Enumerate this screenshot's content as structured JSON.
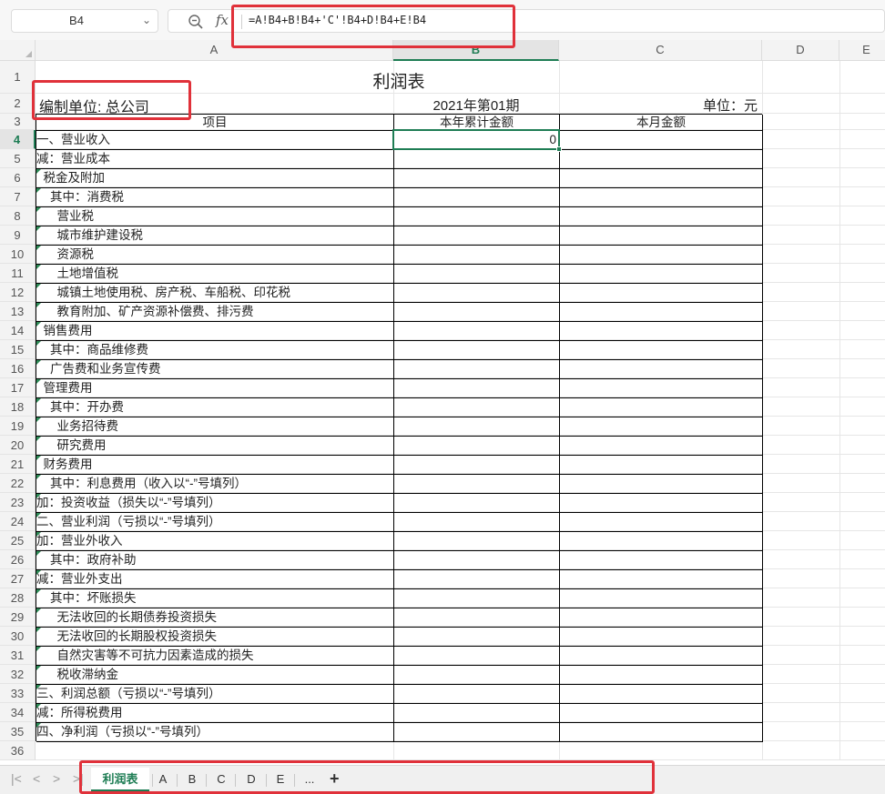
{
  "formula_bar": {
    "cell_ref": "B4",
    "formula": "=A!B4+B!B4+'C'!B4+D!B4+E!B4",
    "fx_label": "fx"
  },
  "columns": [
    "A",
    "B",
    "C",
    "D",
    "E"
  ],
  "active_column": "B",
  "active_row": "4",
  "sheet": {
    "title": "利润表",
    "company_label": "编制单位: 总公司",
    "period": "2021年第01期",
    "unit": "单位：元",
    "headers": [
      "项目",
      "本年累计金额",
      "本月金额"
    ],
    "rows": [
      {
        "item": "一、营业收入",
        "ytd": "0",
        "month": ""
      },
      {
        "item": "减：营业成本",
        "ytd": "",
        "month": ""
      },
      {
        "item": "  税金及附加",
        "ytd": "",
        "month": ""
      },
      {
        "item": "    其中：消费税",
        "ytd": "",
        "month": ""
      },
      {
        "item": "      营业税",
        "ytd": "",
        "month": ""
      },
      {
        "item": "      城市维护建设税",
        "ytd": "",
        "month": ""
      },
      {
        "item": "      资源税",
        "ytd": "",
        "month": ""
      },
      {
        "item": "      土地增值税",
        "ytd": "",
        "month": ""
      },
      {
        "item": "      城镇土地使用税、房产税、车船税、印花税",
        "ytd": "",
        "month": ""
      },
      {
        "item": "      教育附加、矿产资源补偿费、排污费",
        "ytd": "",
        "month": ""
      },
      {
        "item": "  销售费用",
        "ytd": "",
        "month": ""
      },
      {
        "item": "    其中：商品维修费",
        "ytd": "",
        "month": ""
      },
      {
        "item": "    广告费和业务宣传费",
        "ytd": "",
        "month": ""
      },
      {
        "item": "  管理费用",
        "ytd": "",
        "month": ""
      },
      {
        "item": "    其中：开办费",
        "ytd": "",
        "month": ""
      },
      {
        "item": "      业务招待费",
        "ytd": "",
        "month": ""
      },
      {
        "item": "      研究费用",
        "ytd": "",
        "month": ""
      },
      {
        "item": "  财务费用",
        "ytd": "",
        "month": ""
      },
      {
        "item": "    其中：利息费用（收入以“-”号填列）",
        "ytd": "",
        "month": ""
      },
      {
        "item": "加：投资收益（损失以“-”号填列）",
        "ytd": "",
        "month": ""
      },
      {
        "item": "二、营业利润（亏损以“-”号填列）",
        "ytd": "",
        "month": ""
      },
      {
        "item": "加：营业外收入",
        "ytd": "",
        "month": ""
      },
      {
        "item": "    其中：政府补助",
        "ytd": "",
        "month": ""
      },
      {
        "item": "减：营业外支出",
        "ytd": "",
        "month": ""
      },
      {
        "item": "    其中：坏账损失",
        "ytd": "",
        "month": ""
      },
      {
        "item": "      无法收回的长期债券投资损失",
        "ytd": "",
        "month": ""
      },
      {
        "item": "      无法收回的长期股权投资损失",
        "ytd": "",
        "month": ""
      },
      {
        "item": "      自然灾害等不可抗力因素造成的损失",
        "ytd": "",
        "month": ""
      },
      {
        "item": "      税收滞纳金",
        "ytd": "",
        "month": ""
      },
      {
        "item": "三、利润总额（亏损以“-”号填列）",
        "ytd": "",
        "month": ""
      },
      {
        "item": "减：所得税费用",
        "ytd": "",
        "month": ""
      },
      {
        "item": "四、净利润（亏损以“-”号填列）",
        "ytd": "",
        "month": ""
      }
    ],
    "row_numbers": [
      "1",
      "2",
      "3",
      "4",
      "5",
      "6",
      "7",
      "8",
      "9",
      "10",
      "11",
      "12",
      "13",
      "14",
      "15",
      "16",
      "17",
      "18",
      "19",
      "20",
      "21",
      "22",
      "23",
      "24",
      "25",
      "26",
      "27",
      "28",
      "29",
      "30",
      "31",
      "32",
      "33",
      "34",
      "35",
      "36"
    ]
  },
  "tabs": {
    "nav": [
      "|<",
      "<",
      ">",
      ">|"
    ],
    "items": [
      "利润表",
      "A",
      "B",
      "C",
      "D",
      "E",
      "..."
    ],
    "active": "利润表",
    "add": "+"
  },
  "colors": {
    "accent": "#1e7d54",
    "highlight_box": "#e0313a",
    "comment_marker": "#2e8b57"
  },
  "icons": {
    "name_box_dropdown": "chevron-down-icon",
    "zoom": "zoom-out-icon",
    "formula": "fx-icon",
    "add_sheet": "plus-icon"
  }
}
